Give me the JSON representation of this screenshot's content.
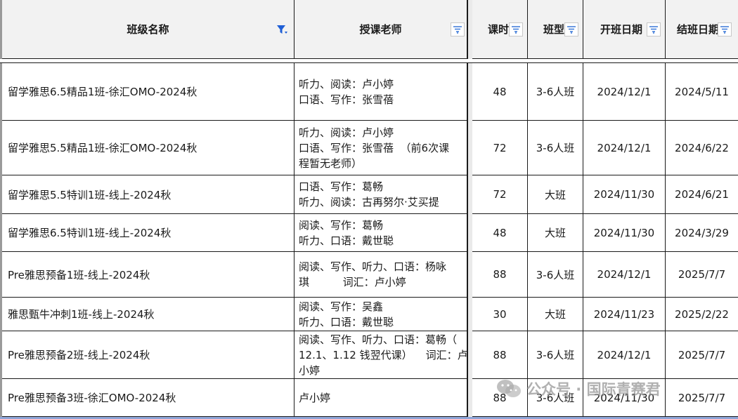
{
  "header": {
    "columns": [
      {
        "key": "class_name",
        "label": "班级名称"
      },
      {
        "key": "teacher",
        "label": "授课老师"
      },
      {
        "key": "hours",
        "label": "课时"
      },
      {
        "key": "type",
        "label": "班型"
      },
      {
        "key": "start",
        "label": "开班日期"
      },
      {
        "key": "end",
        "label": "结班日期"
      }
    ]
  },
  "rows": [
    {
      "class_name": "留学雅思6.5精品1班-徐汇OMO-2024秋",
      "teacher_lines": [
        "听力、阅读：卢小婷",
        "口语、写作：张雪蓓"
      ],
      "hours": "48",
      "type": "3-6人班",
      "start": "2024/12/1",
      "end": "2024/5/11"
    },
    {
      "class_name": "留学雅思5.5精品1班-徐汇OMO-2024秋",
      "teacher_lines": [
        "听力、阅读：卢小婷",
        "口语、写作：张雪蓓  （前6次课",
        "程暂无老师）"
      ],
      "hours": "72",
      "type": "3-6人班",
      "start": "2024/12/1",
      "end": "2024/6/22"
    },
    {
      "class_name": "留学雅思5.5特训1班-线上-2024秋",
      "teacher_lines": [
        "口语、写作：葛畅",
        "听力、阅读：古再努尔·艾买提"
      ],
      "hours": "72",
      "type": "大班",
      "start": "2024/11/30",
      "end": "2024/6/21"
    },
    {
      "class_name": "留学雅思6.5特训1班-线上-2024秋",
      "teacher_lines": [
        "阅读、写作：葛畅",
        "听力、口语：戴世聪"
      ],
      "hours": "48",
      "type": "大班",
      "start": "2024/11/30",
      "end": "2024/3/29"
    },
    {
      "class_name": "Pre雅思预备1班-线上-2024秋",
      "teacher_lines": [
        "阅读、写作、听力、口语：杨咏",
        "琪          词汇：卢小婷"
      ],
      "hours": "88",
      "type": "3-6人班",
      "start": "2024/12/1",
      "end": "2025/7/7"
    },
    {
      "class_name": "雅思甄牛冲刺1班-线上-2024秋",
      "teacher_lines": [
        "阅读、写作：吴鑫",
        "听力、口语：戴世聪"
      ],
      "hours": "30",
      "type": "大班",
      "start": "2024/11/23",
      "end": "2025/2/22"
    },
    {
      "class_name": "Pre雅思预备2班-线上-2024秋",
      "teacher_lines": [
        "阅读、写作、听力、口语：葛畅（",
        "12.1、1.12 钱翌代课）    词汇：卢",
        "小婷"
      ],
      "hours": "88",
      "type": "3-6人班",
      "start": "2024/12/1",
      "end": "2025/7/7"
    },
    {
      "class_name": "Pre雅思预备3班-徐汇OMO-2024秋",
      "teacher_lines": [
        "卢小婷"
      ],
      "hours": "88",
      "type": "3-6人班",
      "start": "2024/11/30",
      "end": "2025/7/7"
    }
  ],
  "watermark": {
    "text": "公众号 · 国际青赛君",
    "icon": "wechat-icon"
  },
  "colors": {
    "filter_active": "#1f5fd6",
    "filter_inactive": "#3a78d8",
    "grid": "#1a1a1a",
    "header_bg": "#f2f2f2"
  }
}
